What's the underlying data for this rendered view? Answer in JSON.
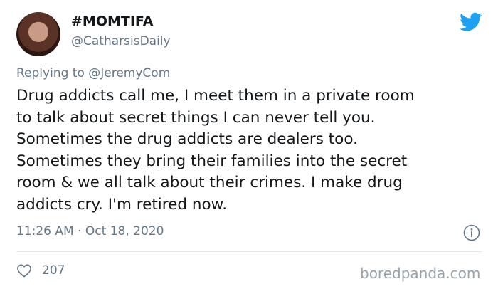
{
  "tweet": {
    "display_name": "#MOMTIFA",
    "handle": "@CatharsisDaily",
    "reply_prefix": "Replying to",
    "reply_to": "@JeremyCom",
    "text": "Drug addicts call me, I meet them in a private room\nto talk about secret things I can never tell you.\nSometimes the drug addicts are dealers too.\nSometimes they bring their families into the secret\nroom & we all talk about their crimes. I make drug\naddicts cry. I'm retired now.",
    "timestamp": "11:26 AM · Oct 18, 2020",
    "like_count": "207"
  },
  "watermark": "boredpanda.com",
  "icons": {
    "brand": "twitter-bird-icon",
    "info": "info-icon",
    "like": "heart-icon"
  },
  "colors": {
    "twitter_blue": "#1da1f2",
    "secondary_text": "#657786",
    "primary_text": "#14171a",
    "divider": "#e1e8ed"
  }
}
